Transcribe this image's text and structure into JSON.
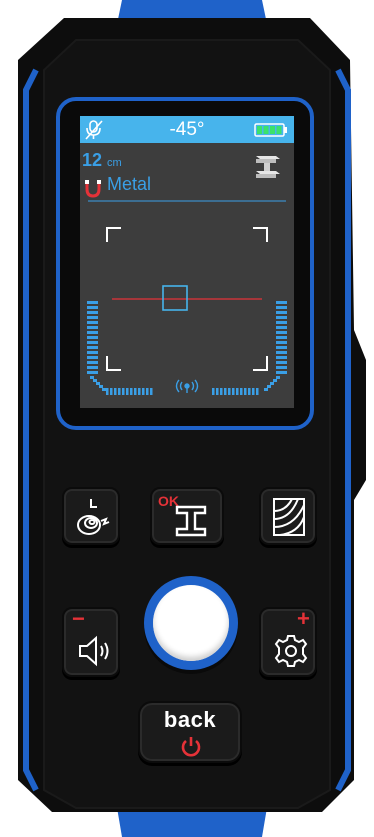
{
  "device": {
    "display": {
      "temperature": "-45°",
      "depth_value": "12",
      "depth_unit": "cm",
      "material": "Metal",
      "icons": {
        "mic": "mic-muted-icon",
        "battery": "battery-full-icon",
        "beam": "i-beam-icon",
        "magnet": "magnet-icon",
        "wireless": "wireless-signal-icon"
      }
    },
    "buttons": {
      "ok_label": "OK",
      "back_label": "back",
      "minus_label": "−",
      "plus_label": "+"
    },
    "colors": {
      "accent_blue": "#1f62c9",
      "screen_cyan": "#47b4ec",
      "text_blue": "#3a9fe6",
      "warning_red": "#e53238",
      "battery_green": "#3be26b"
    }
  }
}
